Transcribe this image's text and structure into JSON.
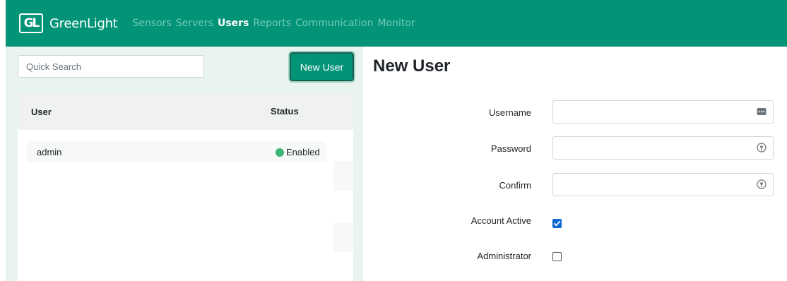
{
  "app": {
    "logo_text": "GL",
    "brand": "GreenLight"
  },
  "nav": {
    "items": [
      {
        "label": "Sensors",
        "active": false
      },
      {
        "label": "Servers",
        "active": false
      },
      {
        "label": "Users",
        "active": true
      },
      {
        "label": "Reports",
        "active": false
      },
      {
        "label": "Communication",
        "active": false
      },
      {
        "label": "Monitor",
        "active": false
      }
    ]
  },
  "sidebar": {
    "search": {
      "placeholder": "Quick Search",
      "value": ""
    },
    "new_user_label": "New User",
    "table": {
      "headers": {
        "user": "User",
        "status": "Status"
      },
      "rows": [
        {
          "user": "admin",
          "status": "Enabled",
          "status_color": "#3cb371"
        }
      ]
    }
  },
  "form": {
    "title": "New User",
    "username_label": "Username",
    "password_label": "Password",
    "confirm_label": "Confirm",
    "account_active_label": "Account Active",
    "account_active_checked": true,
    "administrator_label": "Administrator",
    "administrator_checked": false
  },
  "colors": {
    "brand": "#039377",
    "panel_bg": "#e9f3ef",
    "checkbox_accent": "#0d6ad3"
  }
}
